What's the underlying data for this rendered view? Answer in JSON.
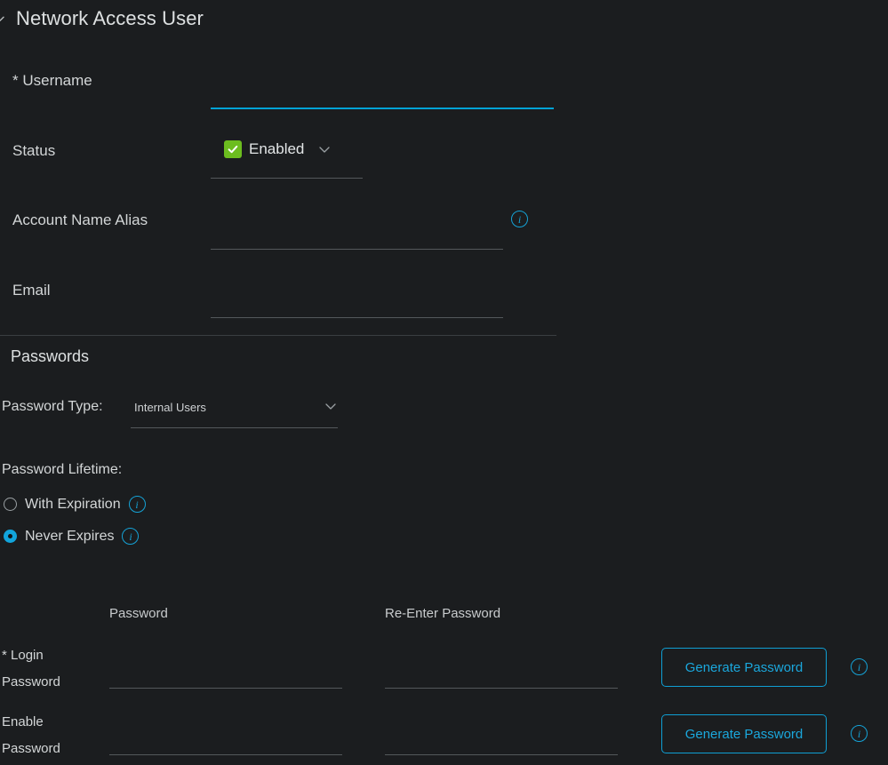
{
  "theme": {
    "background": "#1b1d1f",
    "text": "#d5d8d9",
    "accent_cyan": "#15a2d6",
    "accent_green": "#6cbd1f",
    "underline": "#54585b",
    "focused_underline": "#00a3d6"
  },
  "section": {
    "title": "Network Access User",
    "collapse_icon": "chevron-down-icon"
  },
  "fields": {
    "username": {
      "label": "* Username",
      "value": "",
      "placeholder": "",
      "focused": true
    },
    "status": {
      "label": "Status",
      "selected": "Enabled",
      "checked": true,
      "dropdown_icon": "chevron-down-icon"
    },
    "account_name_alias": {
      "label": "Account Name Alias",
      "value": "",
      "placeholder": "",
      "info_icon": "info-icon"
    },
    "email": {
      "label": "Email",
      "value": "",
      "placeholder": ""
    }
  },
  "passwords": {
    "heading": "Passwords",
    "password_type": {
      "label": "Password Type:",
      "selected": "Internal Users",
      "dropdown_icon": "chevron-down-icon"
    },
    "lifetime": {
      "label": "Password Lifetime:",
      "options": [
        {
          "label": "With Expiration",
          "selected": false,
          "info_icon": "info-icon"
        },
        {
          "label": "Never Expires",
          "selected": true,
          "info_icon": "info-icon"
        }
      ]
    },
    "table": {
      "columns": [
        "Password",
        "Re-Enter Password"
      ],
      "rows": [
        {
          "label_line1": "* Login",
          "label_line2": "Password",
          "password_value": "",
          "reenter_value": "",
          "button_label": "Generate Password",
          "info_icon": "info-icon"
        },
        {
          "label_line1": "Enable",
          "label_line2": "Password",
          "password_value": "",
          "reenter_value": "",
          "button_label": "Generate Password",
          "info_icon": "info-icon"
        }
      ]
    }
  }
}
